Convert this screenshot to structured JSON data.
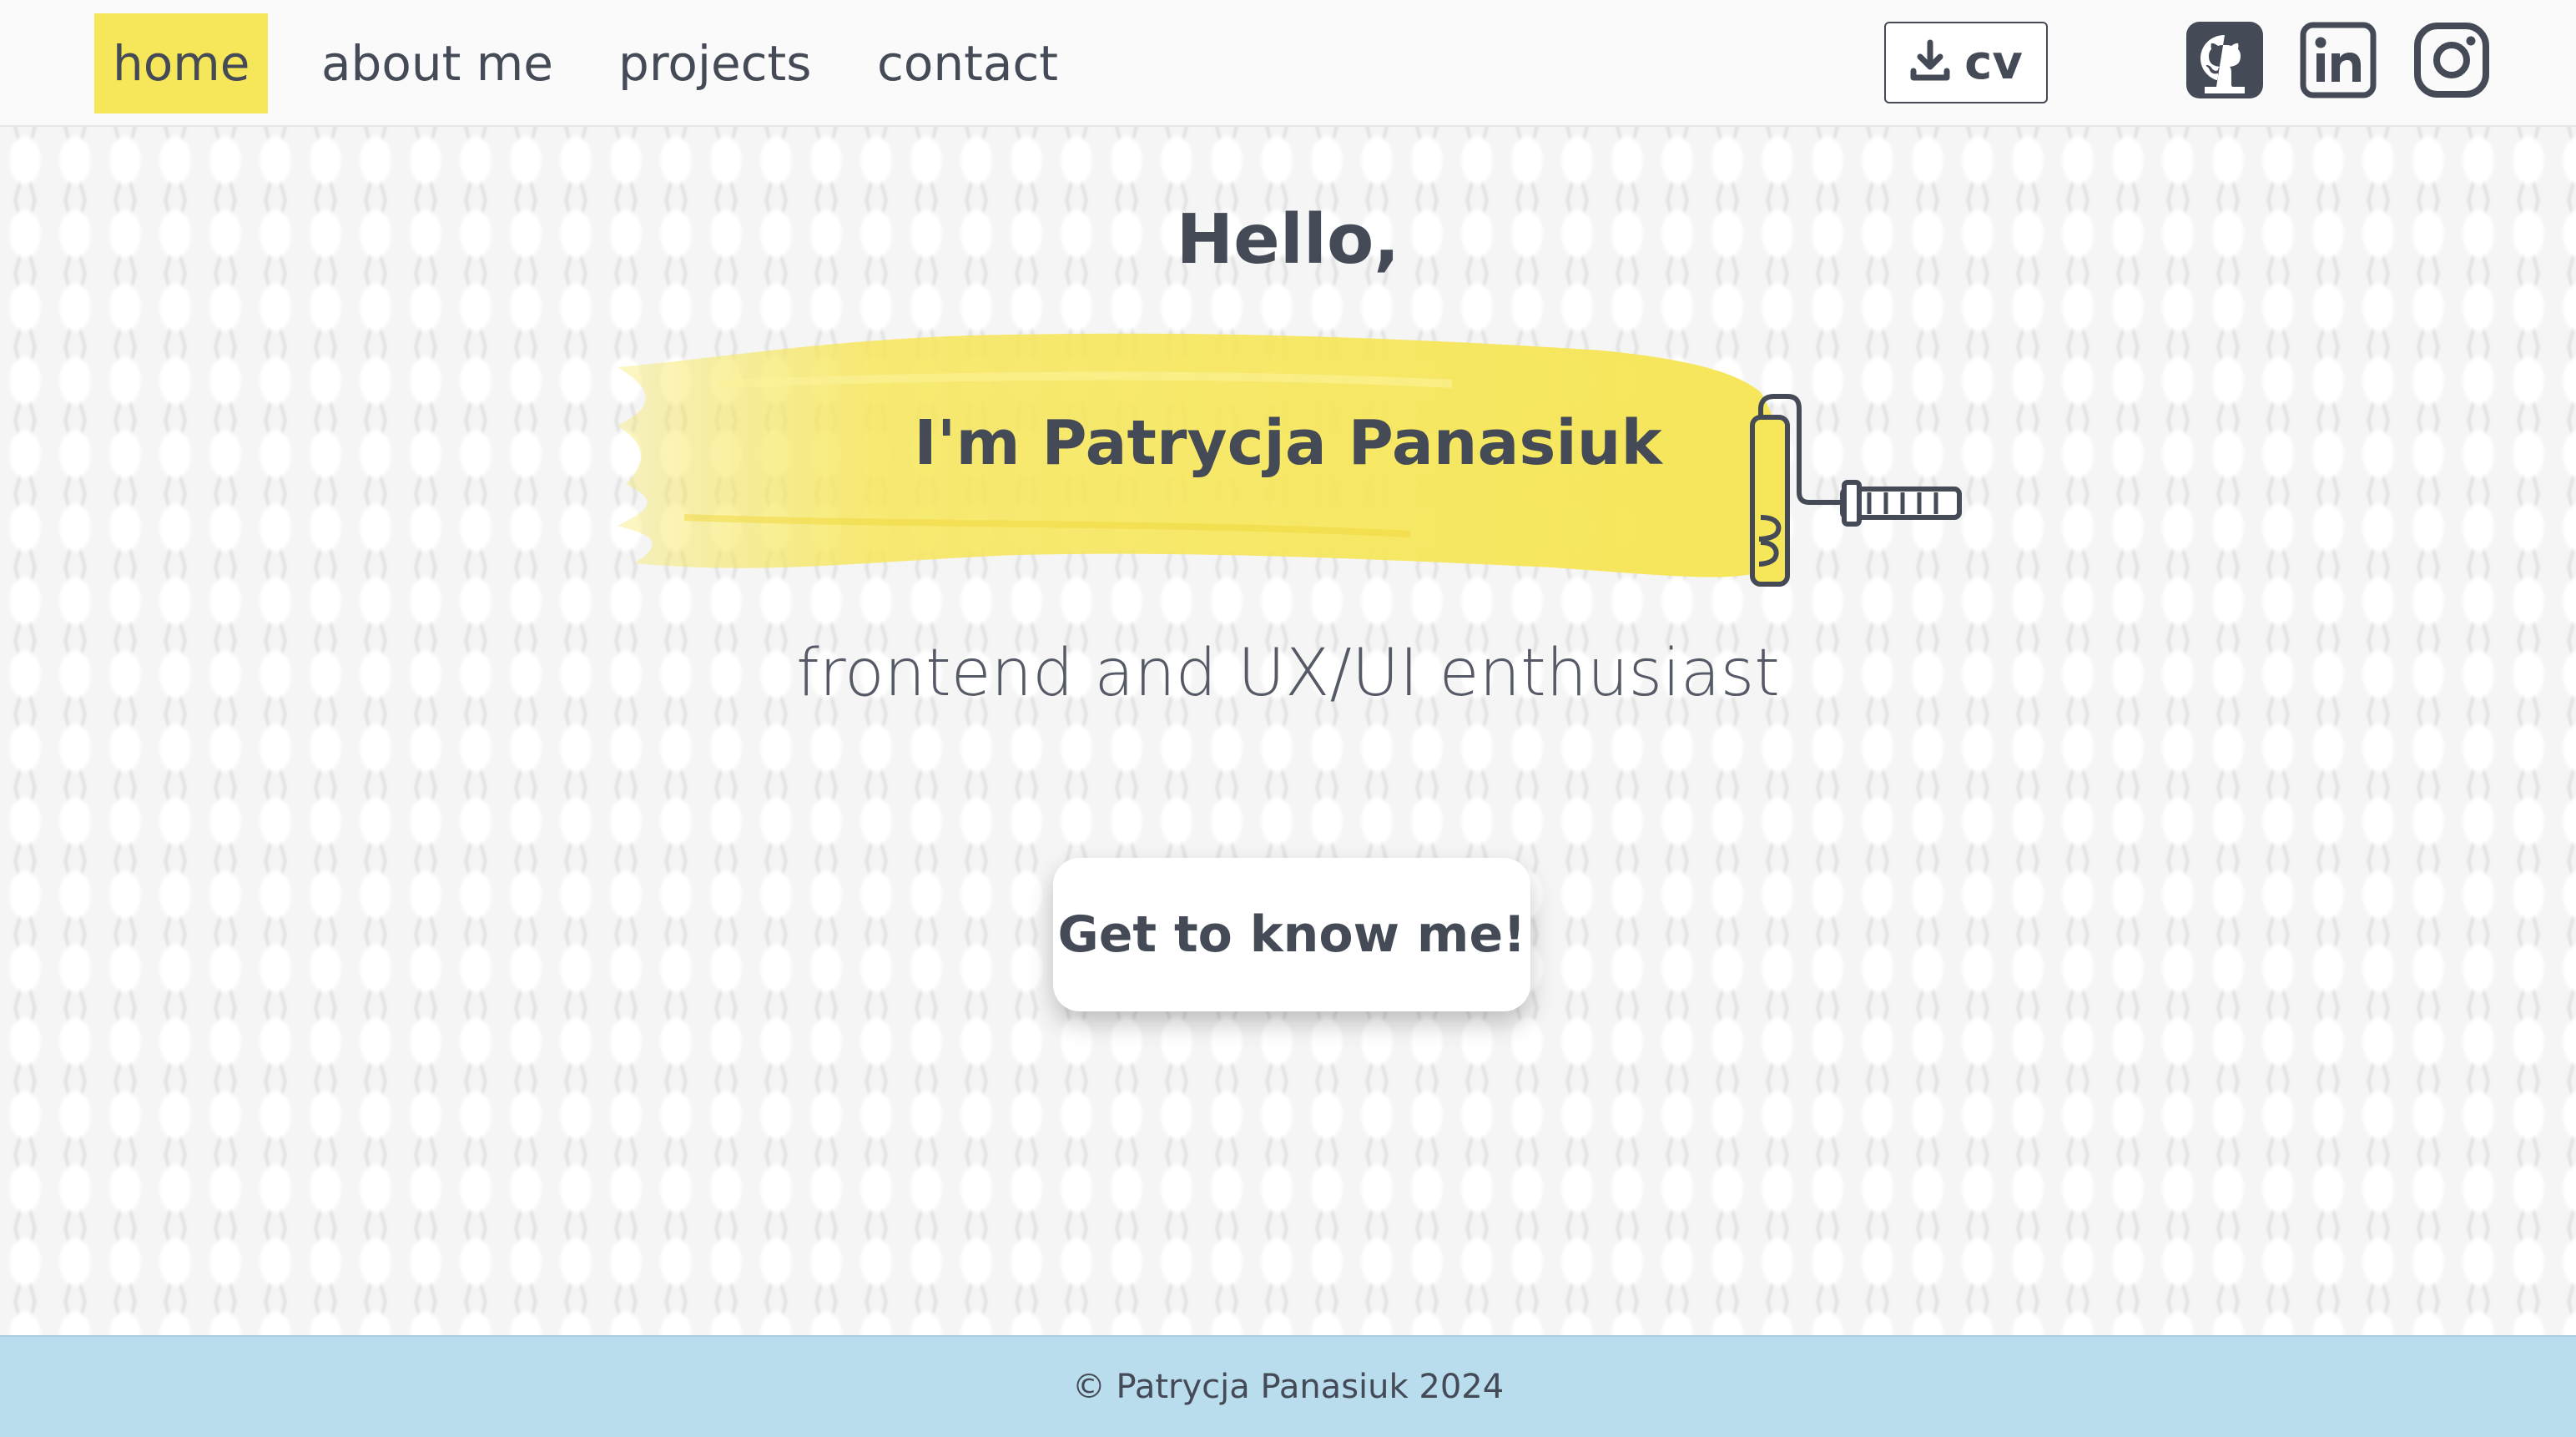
{
  "nav": {
    "items": [
      {
        "label": "home",
        "active": true
      },
      {
        "label": "about me",
        "active": false
      },
      {
        "label": "projects",
        "active": false
      },
      {
        "label": "contact",
        "active": false
      }
    ],
    "cv_label": "cv",
    "icons": {
      "download": "download-icon",
      "github": "github-icon",
      "linkedin": "linkedin-icon",
      "instagram": "instagram-icon"
    }
  },
  "hero": {
    "greeting": "Hello,",
    "name": "I'm Patrycja Panasiuk",
    "tagline": "frontend and UX/UI enthusiast",
    "cta_label": "Get to know me!",
    "illustration": "paint-roller-icon"
  },
  "footer": {
    "text": "© Patrycja Panasiuk 2024"
  },
  "colors": {
    "accent_yellow": "#f6e65a",
    "text_dark": "#454a57",
    "footer_blue": "#b9ddec"
  }
}
